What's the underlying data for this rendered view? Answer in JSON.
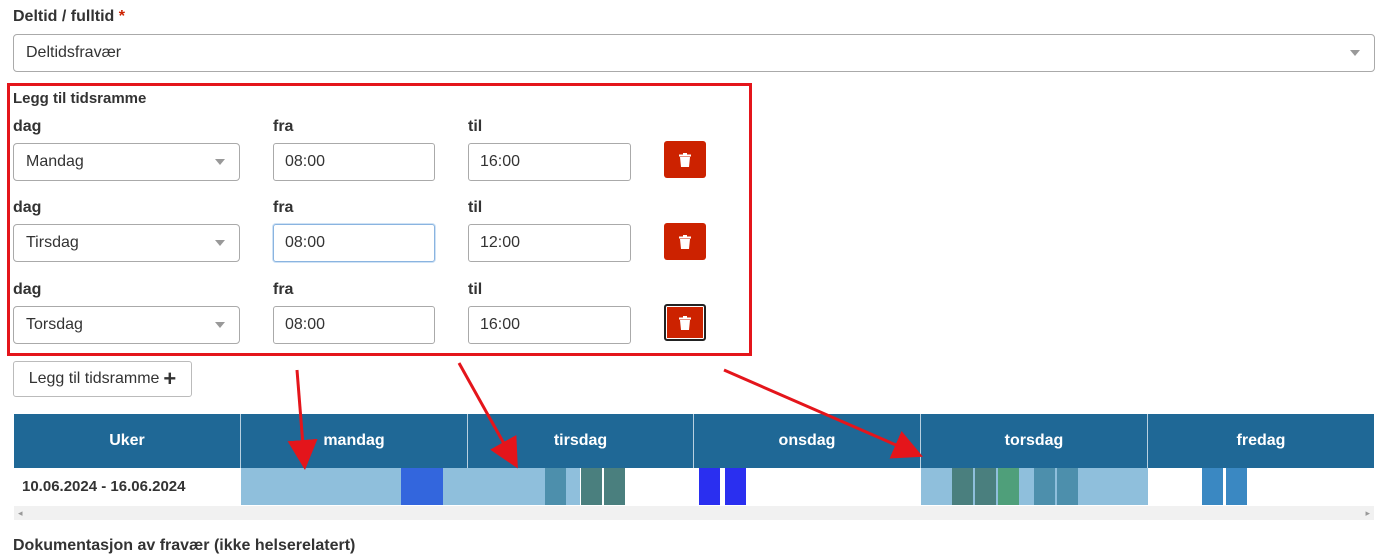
{
  "section": {
    "label": "Deltid / fulltid",
    "required_mark": "*",
    "select_value": "Deltidsfravær"
  },
  "timeframe": {
    "heading": "Legg til tidsramme",
    "col_day": "dag",
    "col_from": "fra",
    "col_to": "til",
    "rows": [
      {
        "day": "Mandag",
        "from": "08:00",
        "to": "16:00"
      },
      {
        "day": "Tirsdag",
        "from": "08:00",
        "to": "12:00"
      },
      {
        "day": "Torsdag",
        "from": "08:00",
        "to": "16:00"
      }
    ],
    "add_button_label": "Legg til tidsramme",
    "add_button_icon": "+"
  },
  "schedule": {
    "headers": [
      "Uker",
      "mandag",
      "tirsdag",
      "onsdag",
      "torsdag",
      "fredag"
    ],
    "week_label": "10.06.2024 - 16.06.2024",
    "colors": {
      "header_bg": "#1f6896",
      "light_block": "#8fbfdc",
      "teal": "#4d8fac",
      "dark_teal": "#4a7f7e",
      "green": "#4f9f7a",
      "bright_blue": "#2a2ff0",
      "royal_blue": "#3366dd",
      "mid_blue": "#3a88c2"
    }
  },
  "footer_cut_text": "Dokumentasjon av fravær (ikke helserelatert)",
  "annotation": {
    "color": "#e4151b"
  },
  "icons": {
    "delete": "trash-icon",
    "select": "chevron-down-icon"
  }
}
